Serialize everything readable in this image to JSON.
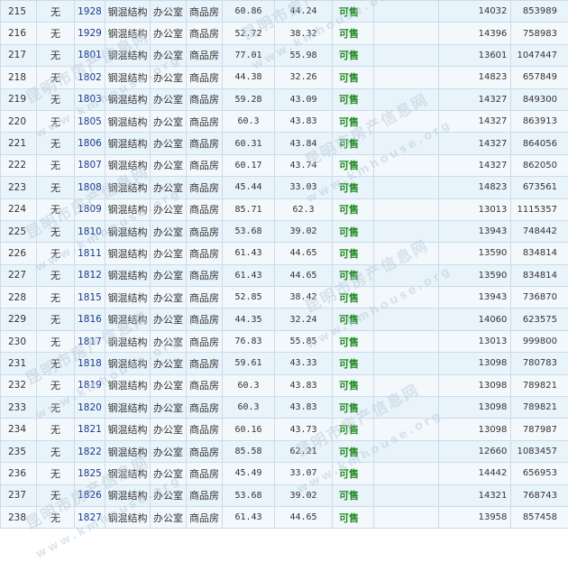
{
  "rows": [
    {
      "seq": "215",
      "none": "无",
      "room": "1928",
      "structure": "钢混结构",
      "use": "办公室",
      "type": "商品房",
      "area": "60.86",
      "inner": "44.24",
      "status": "可售",
      "price": "14032",
      "total": "853989"
    },
    {
      "seq": "216",
      "none": "无",
      "room": "1929",
      "structure": "钢混结构",
      "use": "办公室",
      "type": "商品房",
      "area": "52.72",
      "inner": "38.32",
      "status": "可售",
      "price": "14396",
      "total": "758983"
    },
    {
      "seq": "217",
      "none": "无",
      "room": "1801",
      "structure": "钢混结构",
      "use": "办公室",
      "type": "商品房",
      "area": "77.01",
      "inner": "55.98",
      "status": "可售",
      "price": "13601",
      "total": "1047447"
    },
    {
      "seq": "218",
      "none": "无",
      "room": "1802",
      "structure": "钢混结构",
      "use": "办公室",
      "type": "商品房",
      "area": "44.38",
      "inner": "32.26",
      "status": "可售",
      "price": "14823",
      "total": "657849"
    },
    {
      "seq": "219",
      "none": "无",
      "room": "1803",
      "structure": "钢混结构",
      "use": "办公室",
      "type": "商品房",
      "area": "59.28",
      "inner": "43.09",
      "status": "可售",
      "price": "14327",
      "total": "849300"
    },
    {
      "seq": "220",
      "none": "无",
      "room": "1805",
      "structure": "钢混结构",
      "use": "办公室",
      "type": "商品房",
      "area": "60.3",
      "inner": "43.83",
      "status": "可售",
      "price": "14327",
      "total": "863913"
    },
    {
      "seq": "221",
      "none": "无",
      "room": "1806",
      "structure": "钢混结构",
      "use": "办公室",
      "type": "商品房",
      "area": "60.31",
      "inner": "43.84",
      "status": "可售",
      "price": "14327",
      "total": "864056"
    },
    {
      "seq": "222",
      "none": "无",
      "room": "1807",
      "structure": "钢混结构",
      "use": "办公室",
      "type": "商品房",
      "area": "60.17",
      "inner": "43.74",
      "status": "可售",
      "price": "14327",
      "total": "862050"
    },
    {
      "seq": "223",
      "none": "无",
      "room": "1808",
      "structure": "钢混结构",
      "use": "办公室",
      "type": "商品房",
      "area": "45.44",
      "inner": "33.03",
      "status": "可售",
      "price": "14823",
      "total": "673561"
    },
    {
      "seq": "224",
      "none": "无",
      "room": "1809",
      "structure": "钢混结构",
      "use": "办公室",
      "type": "商品房",
      "area": "85.71",
      "inner": "62.3",
      "status": "可售",
      "price": "13013",
      "total": "1115357"
    },
    {
      "seq": "225",
      "none": "无",
      "room": "1810",
      "structure": "钢混结构",
      "use": "办公室",
      "type": "商品房",
      "area": "53.68",
      "inner": "39.02",
      "status": "可售",
      "price": "13943",
      "total": "748442"
    },
    {
      "seq": "226",
      "none": "无",
      "room": "1811",
      "structure": "钢混结构",
      "use": "办公室",
      "type": "商品房",
      "area": "61.43",
      "inner": "44.65",
      "status": "可售",
      "price": "13590",
      "total": "834814"
    },
    {
      "seq": "227",
      "none": "无",
      "room": "1812",
      "structure": "钢混结构",
      "use": "办公室",
      "type": "商品房",
      "area": "61.43",
      "inner": "44.65",
      "status": "可售",
      "price": "13590",
      "total": "834814"
    },
    {
      "seq": "228",
      "none": "无",
      "room": "1815",
      "structure": "钢混结构",
      "use": "办公室",
      "type": "商品房",
      "area": "52.85",
      "inner": "38.42",
      "status": "可售",
      "price": "13943",
      "total": "736870"
    },
    {
      "seq": "229",
      "none": "无",
      "room": "1816",
      "structure": "钢混结构",
      "use": "办公室",
      "type": "商品房",
      "area": "44.35",
      "inner": "32.24",
      "status": "可售",
      "price": "14060",
      "total": "623575"
    },
    {
      "seq": "230",
      "none": "无",
      "room": "1817",
      "structure": "钢混结构",
      "use": "办公室",
      "type": "商品房",
      "area": "76.83",
      "inner": "55.85",
      "status": "可售",
      "price": "13013",
      "total": "999800"
    },
    {
      "seq": "231",
      "none": "无",
      "room": "1818",
      "structure": "钢混结构",
      "use": "办公室",
      "type": "商品房",
      "area": "59.61",
      "inner": "43.33",
      "status": "可售",
      "price": "13098",
      "total": "780783"
    },
    {
      "seq": "232",
      "none": "无",
      "room": "1819",
      "structure": "钢混结构",
      "use": "办公室",
      "type": "商品房",
      "area": "60.3",
      "inner": "43.83",
      "status": "可售",
      "price": "13098",
      "total": "789821"
    },
    {
      "seq": "233",
      "none": "无",
      "room": "1820",
      "structure": "钢混结构",
      "use": "办公室",
      "type": "商品房",
      "area": "60.3",
      "inner": "43.83",
      "status": "可售",
      "price": "13098",
      "total": "789821"
    },
    {
      "seq": "234",
      "none": "无",
      "room": "1821",
      "structure": "钢混结构",
      "use": "办公室",
      "type": "商品房",
      "area": "60.16",
      "inner": "43.73",
      "status": "可售",
      "price": "13098",
      "total": "787987"
    },
    {
      "seq": "235",
      "none": "无",
      "room": "1822",
      "structure": "钢混结构",
      "use": "办公室",
      "type": "商品房",
      "area": "85.58",
      "inner": "62.21",
      "status": "可售",
      "price": "12660",
      "total": "1083457"
    },
    {
      "seq": "236",
      "none": "无",
      "room": "1825",
      "structure": "钢混结构",
      "use": "办公室",
      "type": "商品房",
      "area": "45.49",
      "inner": "33.07",
      "status": "可售",
      "price": "14442",
      "total": "656953"
    },
    {
      "seq": "237",
      "none": "无",
      "room": "1826",
      "structure": "钢混结构",
      "use": "办公室",
      "type": "商品房",
      "area": "53.68",
      "inner": "39.02",
      "status": "可售",
      "price": "14321",
      "total": "768743"
    },
    {
      "seq": "238",
      "none": "无",
      "room": "1827",
      "structure": "钢混结构",
      "use": "办公室",
      "type": "商品房",
      "area": "61.43",
      "inner": "44.65",
      "status": "可售",
      "price": "13958",
      "total": "857458"
    }
  ],
  "watermark": {
    "cn": "昆明市房产信息网",
    "en": "www.kmhouse.org"
  },
  "colors": {
    "status": "#1f8a1f",
    "room": "#1a3a8c",
    "row_odd": "#e9f3fa",
    "row_even": "#f3f8fc",
    "border": "#c9dcec"
  }
}
